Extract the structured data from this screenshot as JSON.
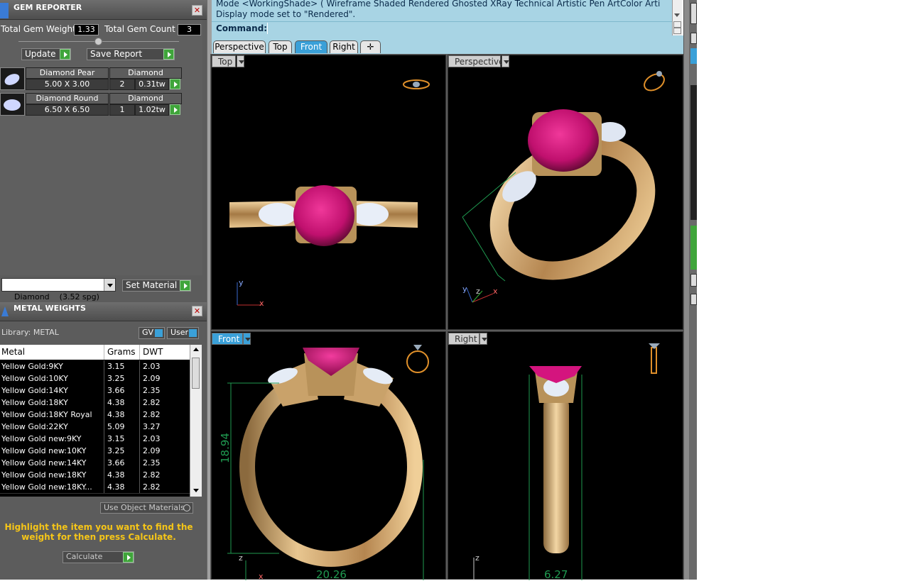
{
  "gem_reporter": {
    "title": "GEM REPORTER",
    "total_weight_label": "Total Gem Weight",
    "total_weight_value": "1.33",
    "total_count_label": "Total Gem Count",
    "total_count_value": "3",
    "update_label": "Update",
    "save_report_label": "Save Report",
    "gems": [
      {
        "shape": "Diamond Pear",
        "material": "Diamond",
        "size": "5.00 X 3.00",
        "count": "2",
        "weight": "0.31tw"
      },
      {
        "shape": "Diamond Round",
        "material": "Diamond",
        "size": "6.50 X 6.50",
        "count": "1",
        "weight": "1.02tw"
      }
    ],
    "material_select": "Diamond    (3.52 spg)",
    "set_material_label": "Set Material"
  },
  "metal_weights": {
    "title": "METAL WEIGHTS",
    "library_label": "Library: METAL",
    "gv_label": "GV",
    "user_label": "User",
    "columns": [
      "Metal",
      "Grams",
      "DWT"
    ],
    "rows": [
      [
        "Yellow Gold:9KY",
        "3.15",
        "2.03"
      ],
      [
        "Yellow Gold:10KY",
        "3.25",
        "2.09"
      ],
      [
        "Yellow Gold:14KY",
        "3.66",
        "2.35"
      ],
      [
        "Yellow Gold:18KY",
        "4.38",
        "2.82"
      ],
      [
        "Yellow Gold:18KY Royal",
        "4.38",
        "2.82"
      ],
      [
        "Yellow Gold:22KY",
        "5.09",
        "3.27"
      ],
      [
        "Yellow Gold new:9KY",
        "3.15",
        "2.03"
      ],
      [
        "Yellow Gold new:10KY",
        "3.25",
        "2.09"
      ],
      [
        "Yellow Gold new:14KY",
        "3.66",
        "2.35"
      ],
      [
        "Yellow Gold new:18KY",
        "4.38",
        "2.82"
      ],
      [
        "Yellow Gold new:18KY...",
        "4.38",
        "2.82"
      ]
    ],
    "use_object_materials_label": "Use Object Materials",
    "hint": "Highlight the item you want to find the weight for then press Calculate.",
    "calculate_label": "Calculate"
  },
  "command": {
    "line1": "Mode <WorkingShade> ( Wireframe  Shaded  Rendered  Ghosted  XRay  Technical  Artistic  Pen  ArtColor  Arti",
    "line2": "Display mode set to \"Rendered\".",
    "prompt_label": "Command:"
  },
  "tabs": [
    "Perspective",
    "Top",
    "Front",
    "Right"
  ],
  "active_tab": "Front",
  "viewports": {
    "top": "Top",
    "perspective": "Perspective",
    "front": "Front",
    "right": "Right"
  },
  "dimensions": {
    "front_height": "18.94",
    "front_width": "20.26",
    "right_width": "6.27"
  },
  "axes": {
    "x": "x",
    "y": "y",
    "z": "z"
  },
  "colors": {
    "gem": "#d4147e",
    "metal": "#c9a26a",
    "dim": "#1f9a50",
    "accent": "#3aa0d8"
  }
}
